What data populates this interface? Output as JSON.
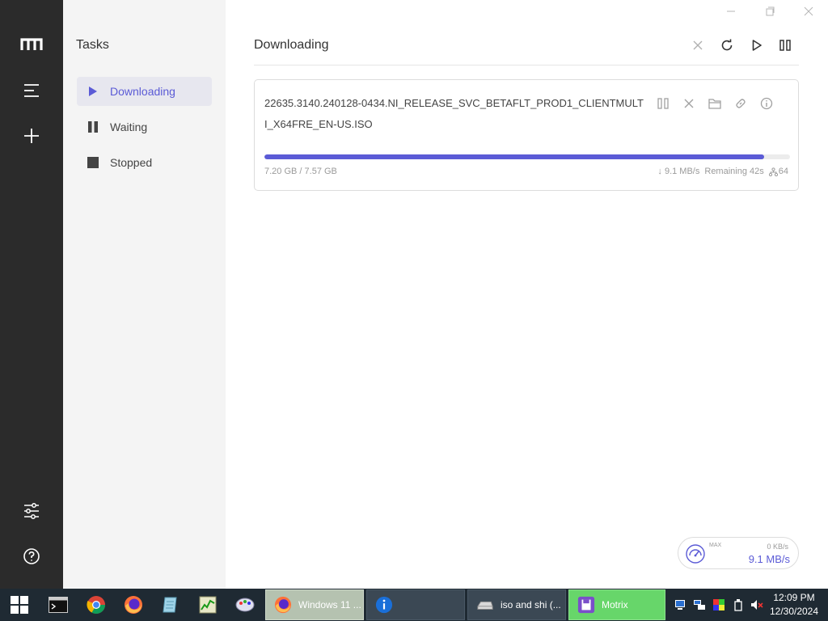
{
  "sidebar": {
    "title": "Tasks",
    "items": [
      {
        "label": "Downloading",
        "icon": "play-icon",
        "active": true
      },
      {
        "label": "Waiting",
        "icon": "pause-icon",
        "active": false
      },
      {
        "label": "Stopped",
        "icon": "stop-icon",
        "active": false
      }
    ]
  },
  "main": {
    "title": "Downloading",
    "toolbar": [
      "delete-icon",
      "refresh-icon",
      "resume-all-icon",
      "pause-all-icon"
    ]
  },
  "task": {
    "name": "22635.3140.240128-0434.NI_RELEASE_SVC_BETAFLT_PROD1_CLIENTMULTI_X64FRE_EN-US.ISO",
    "progress": 0.951,
    "size": "7.20 GB / 7.57 GB",
    "speed": "↓ 9.1 MB/s",
    "remaining": "Remaining 42s",
    "connections": "64",
    "actions": [
      "pause-icon",
      "close-icon",
      "folder-icon",
      "link-icon",
      "info-icon"
    ]
  },
  "speed_widget": {
    "max_label": "MAX",
    "upload": "0 KB/s",
    "download": "9.1 MB/s"
  },
  "taskbar": {
    "apps": [
      {
        "label": "Windows 11 ..."
      },
      {
        "label": ""
      },
      {
        "label": "iso and shi (..."
      },
      {
        "label": "Motrix"
      }
    ],
    "clock_time": "12:09 PM",
    "clock_date": "12/30/2024"
  },
  "colors": {
    "accent": "#5b5bd6",
    "rail": "#2b2b2b",
    "taskbar": "#1f2a33"
  }
}
